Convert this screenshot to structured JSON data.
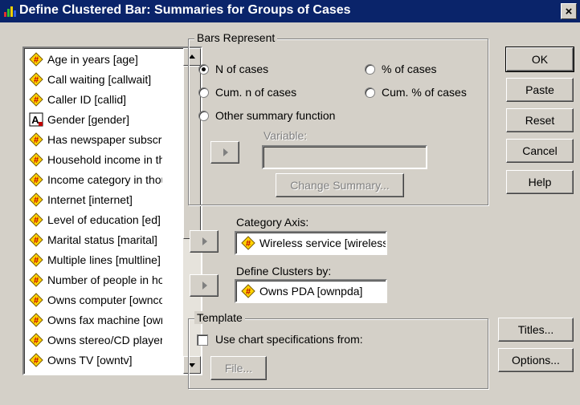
{
  "window": {
    "title": "Define Clustered Bar: Summaries for Groups of Cases",
    "close_glyph": "×"
  },
  "variables": [
    {
      "label": "Age in years [age]",
      "icon": "scale-variable-icon"
    },
    {
      "label": "Call waiting [callwait]",
      "icon": "scale-variable-icon"
    },
    {
      "label": "Caller ID [callid]",
      "icon": "scale-variable-icon"
    },
    {
      "label": "Gender [gender]",
      "icon": "string-variable-icon"
    },
    {
      "label": "Has newspaper subscription",
      "icon": "scale-variable-icon"
    },
    {
      "label": "Household income in thousands",
      "icon": "scale-variable-icon"
    },
    {
      "label": "Income category in thousands",
      "icon": "scale-variable-icon"
    },
    {
      "label": "Internet [internet]",
      "icon": "scale-variable-icon"
    },
    {
      "label": "Level of education [ed]",
      "icon": "scale-variable-icon"
    },
    {
      "label": "Marital status [marital]",
      "icon": "scale-variable-icon"
    },
    {
      "label": "Multiple lines [multline]",
      "icon": "scale-variable-icon"
    },
    {
      "label": "Number of people in household",
      "icon": "scale-variable-icon"
    },
    {
      "label": "Owns computer [owncomp]",
      "icon": "scale-variable-icon"
    },
    {
      "label": "Owns fax machine [ownfax]",
      "icon": "scale-variable-icon"
    },
    {
      "label": "Owns stereo/CD player",
      "icon": "scale-variable-icon"
    },
    {
      "label": "Owns TV [owntv]",
      "icon": "scale-variable-icon"
    }
  ],
  "bars_represent": {
    "group_label": "Bars Represent",
    "n_of_cases": "N of cases",
    "pct_of_cases": "% of cases",
    "cum_n_of_cases": "Cum. n of cases",
    "cum_pct_of_cases": "Cum. % of cases",
    "other_summary": "Other summary function",
    "selected": "n_of_cases",
    "variable_label": "Variable:",
    "variable_value": "",
    "change_summary": "Change Summary..."
  },
  "category_axis": {
    "label": "Category Axis:",
    "value": "Wireless service [wireless]",
    "icon": "scale-variable-icon"
  },
  "define_clusters": {
    "label": "Define Clusters by:",
    "value": "Owns PDA [ownpda]",
    "icon": "scale-variable-icon"
  },
  "template": {
    "group_label": "Template",
    "checkbox_label": "Use chart specifications from:",
    "checked": false,
    "file_button": "File..."
  },
  "buttons": {
    "ok": "OK",
    "paste": "Paste",
    "reset": "Reset",
    "cancel": "Cancel",
    "help": "Help",
    "titles": "Titles...",
    "options": "Options..."
  },
  "colors": {
    "title_bar": "#0a246a",
    "dialog_face": "#d4d0c8",
    "icon_yellow": "#ffd400",
    "icon_red": "#c00000"
  }
}
